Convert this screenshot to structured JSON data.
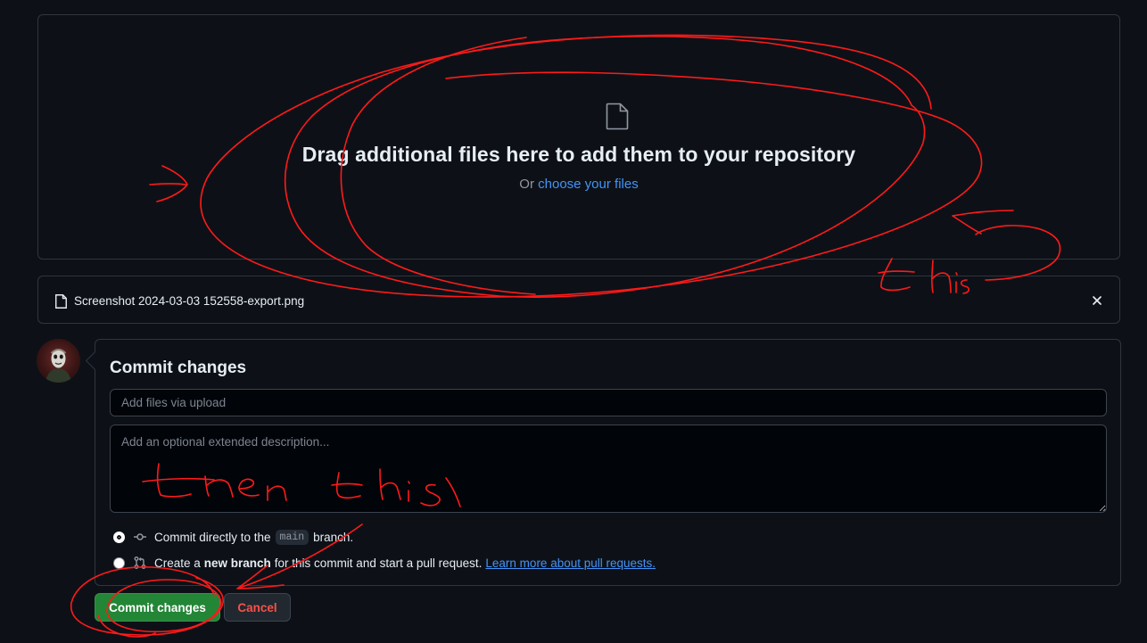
{
  "dropzone": {
    "title": "Drag additional files here to add them to your repository",
    "prefix": "Or",
    "link": "choose your files"
  },
  "uploaded_file": {
    "name": "Screenshot 2024-03-03 152558-export.png"
  },
  "commit": {
    "heading": "Commit changes",
    "summary_placeholder": "Add files via upload",
    "summary_value": "",
    "description_placeholder": "Add an optional extended description...",
    "description_value": "",
    "option_direct": {
      "before": "Commit directly to the",
      "branch": "main",
      "after": "branch.",
      "selected": true
    },
    "option_new_branch": {
      "before": "Create a",
      "bold": "new branch",
      "after": "for this commit and start a pull request.",
      "link": "Learn more about pull requests.",
      "selected": false
    },
    "submit_label": "Commit changes",
    "cancel_label": "Cancel"
  },
  "icons": {
    "dropzone": "file-icon",
    "file_row": "file-icon",
    "remove": "x-icon",
    "direct_commit": "git-commit-icon",
    "pull_request": "git-pull-request-icon"
  },
  "colors": {
    "background": "#0d1117",
    "border": "#30363d",
    "link": "#4493f8",
    "primary_button": "#238636",
    "danger_text": "#f85149",
    "annotation": "#ff1a1a"
  }
}
